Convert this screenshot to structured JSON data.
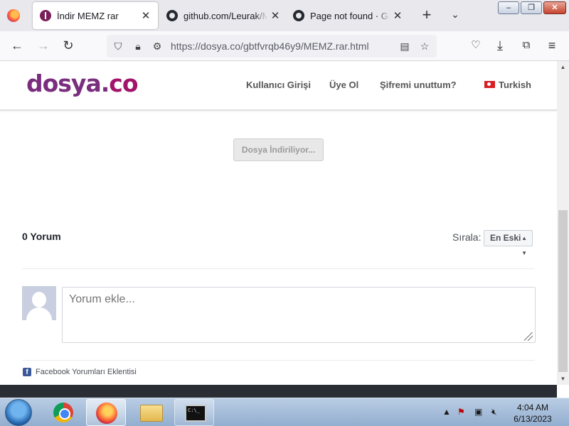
{
  "browser": {
    "tabs": [
      {
        "label": "İndir MEMZ rar",
        "icon": "dosya-icon",
        "active": true
      },
      {
        "label": "github.com/Leurak/MEMZ",
        "icon": "github-icon",
        "active": false
      },
      {
        "label": "Page not found · GitHub",
        "icon": "github-icon",
        "active": false
      }
    ],
    "new_tab": "+",
    "url": "https://dosya.co/gbtfvrqb46y9/MEMZ.rar.html"
  },
  "site": {
    "logo_main": "dosya.",
    "logo_co": "co",
    "menu": {
      "login": "Kullanıcı Girişi",
      "register": "Üye Ol",
      "forgot": "Şifremi unuttum?",
      "language": "Turkish"
    },
    "download_button": "Dosya İndiriliyor..."
  },
  "comments": {
    "count_label": "0 Yorum",
    "sort_label": "Sırala:",
    "sort_selected": "En Eski",
    "placeholder": "Yorum ekle...",
    "plugin_label": "Facebook Yorumları Eklentisi"
  },
  "taskbar": {
    "apps": [
      "start-orb",
      "chrome",
      "firefox",
      "file-explorer",
      "command-prompt"
    ],
    "clock_time": "4:04 AM",
    "clock_date": "6/13/2023"
  }
}
